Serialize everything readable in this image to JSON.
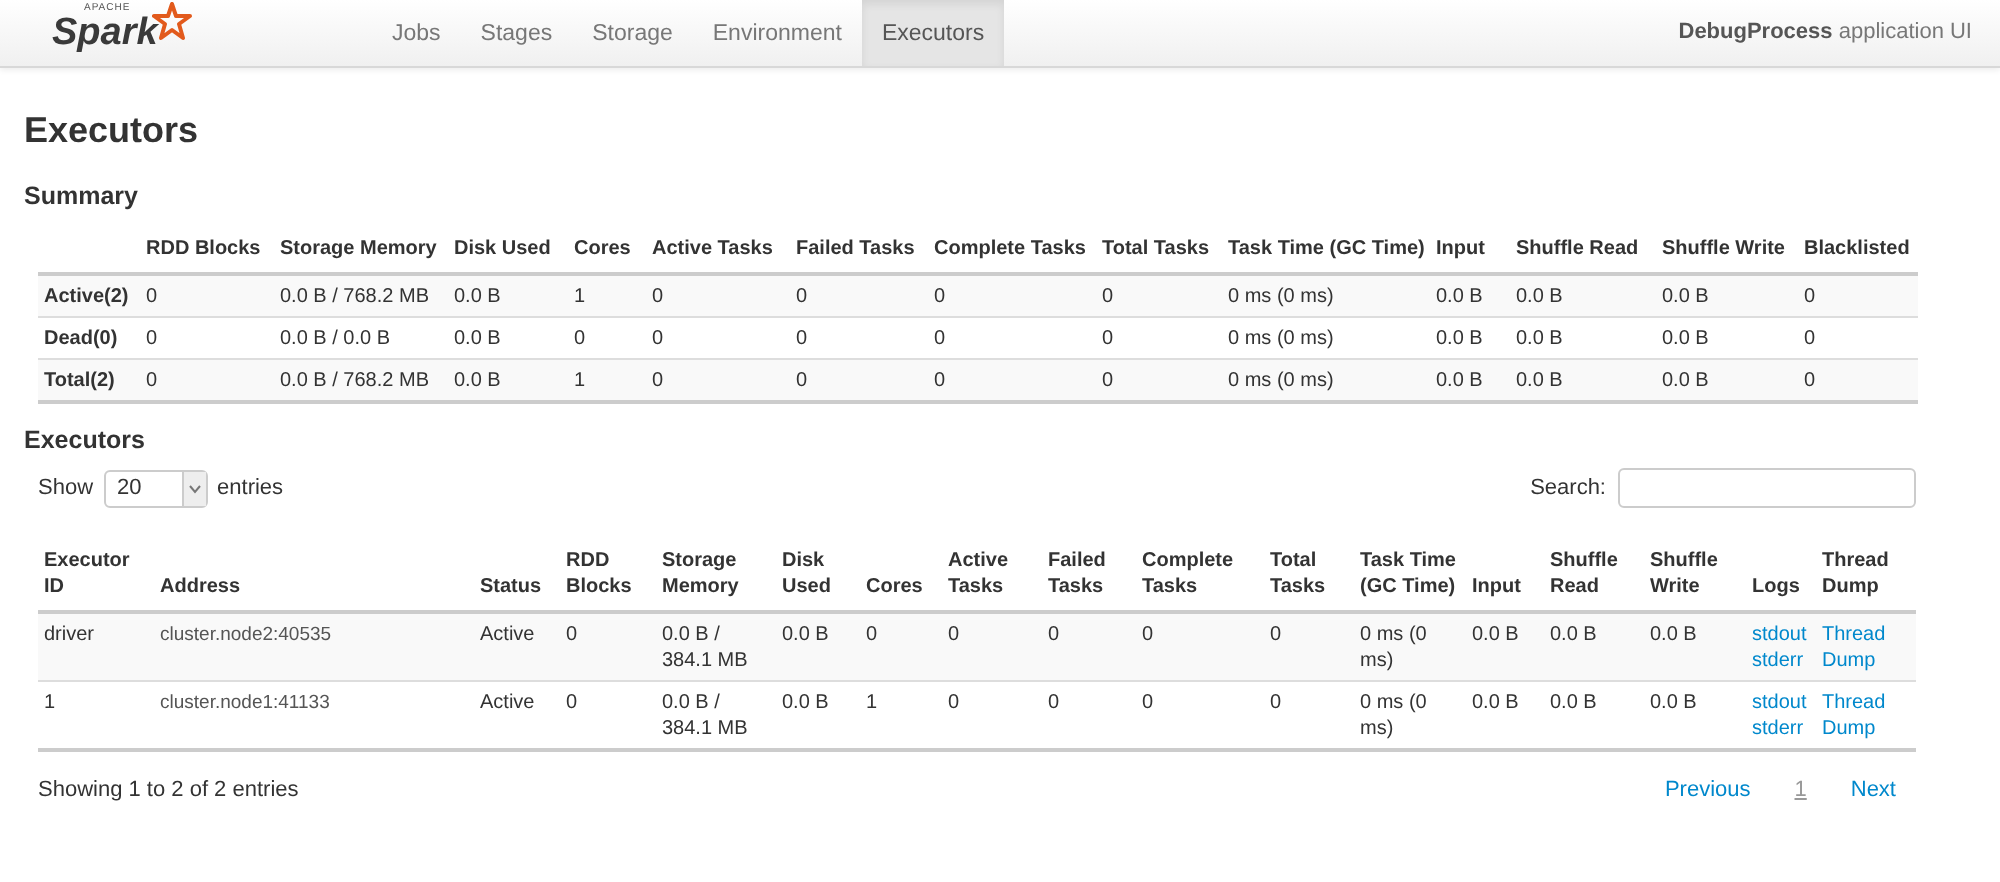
{
  "navbar": {
    "logo": {
      "small": "APACHE",
      "name": "Spark"
    },
    "tabs": [
      {
        "label": "Jobs",
        "selected": false
      },
      {
        "label": "Stages",
        "selected": false
      },
      {
        "label": "Storage",
        "selected": false
      },
      {
        "label": "Environment",
        "selected": false
      },
      {
        "label": "Executors",
        "selected": true
      }
    ],
    "app_title": "**DebugProcess** application UI"
  },
  "page_title": "Executors",
  "summary": {
    "heading": "Summary",
    "columns": [
      "",
      "RDD Blocks",
      "Storage Memory",
      "Disk Used",
      "Cores",
      "Active Tasks",
      "Failed Tasks",
      "Complete Tasks",
      "Total Tasks",
      "Task Time (GC Time)",
      "Input",
      "Shuffle Read",
      "Shuffle Write",
      "Blacklisted"
    ],
    "rows": [
      [
        "Active(2)",
        "0",
        "0.0 B / 768.2 MB",
        "0.0 B",
        "1",
        "0",
        "0",
        "0",
        "0",
        "0 ms (0 ms)",
        "0.0 B",
        "0.0 B",
        "0.0 B",
        "0"
      ],
      [
        "Dead(0)",
        "0",
        "0.0 B / 0.0 B",
        "0.0 B",
        "0",
        "0",
        "0",
        "0",
        "0",
        "0 ms (0 ms)",
        "0.0 B",
        "0.0 B",
        "0.0 B",
        "0"
      ],
      [
        "Total(2)",
        "0",
        "0.0 B / 768.2 MB",
        "0.0 B",
        "1",
        "0",
        "0",
        "0",
        "0",
        "0 ms (0 ms)",
        "0.0 B",
        "0.0 B",
        "0.0 B",
        "0"
      ]
    ]
  },
  "executors": {
    "heading": "Executors",
    "show_label": "Show",
    "page_size": "20",
    "entries_label": "entries",
    "search_label": "Search:",
    "columns": [
      "Executor ID",
      "Address",
      "Status",
      "RDD Blocks",
      "Storage Memory",
      "Disk Used",
      "Cores",
      "Active Tasks",
      "Failed Tasks",
      "Complete Tasks",
      "Total Tasks",
      "Task Time (GC Time)",
      "Input",
      "Shuffle Read",
      "Shuffle Write",
      "Logs",
      "Thread Dump"
    ],
    "rows": [
      {
        "cells": [
          "driver",
          "cluster.node2:40535",
          "Active",
          "0",
          "0.0 B / 384.1 MB",
          "0.0 B",
          "0",
          "0",
          "0",
          "0",
          "0",
          "0 ms (0 ms)",
          "0.0 B",
          "0.0 B",
          "0.0 B"
        ],
        "logs": [
          "stdout",
          "stderr"
        ],
        "thread_dump": "Thread Dump"
      },
      {
        "cells": [
          "1",
          "cluster.node1:41133",
          "Active",
          "0",
          "0.0 B / 384.1 MB",
          "0.0 B",
          "1",
          "0",
          "0",
          "0",
          "0",
          "0 ms (0 ms)",
          "0.0 B",
          "0.0 B",
          "0.0 B"
        ],
        "logs": [
          "stdout",
          "stderr"
        ],
        "thread_dump": "Thread Dump"
      }
    ],
    "info": "Showing 1 to 2 of 2 entries",
    "pagination": [
      {
        "label": "Previous",
        "selected": false
      },
      {
        "label": "1",
        "selected": true
      },
      {
        "label": "Next",
        "selected": false
      }
    ]
  }
}
